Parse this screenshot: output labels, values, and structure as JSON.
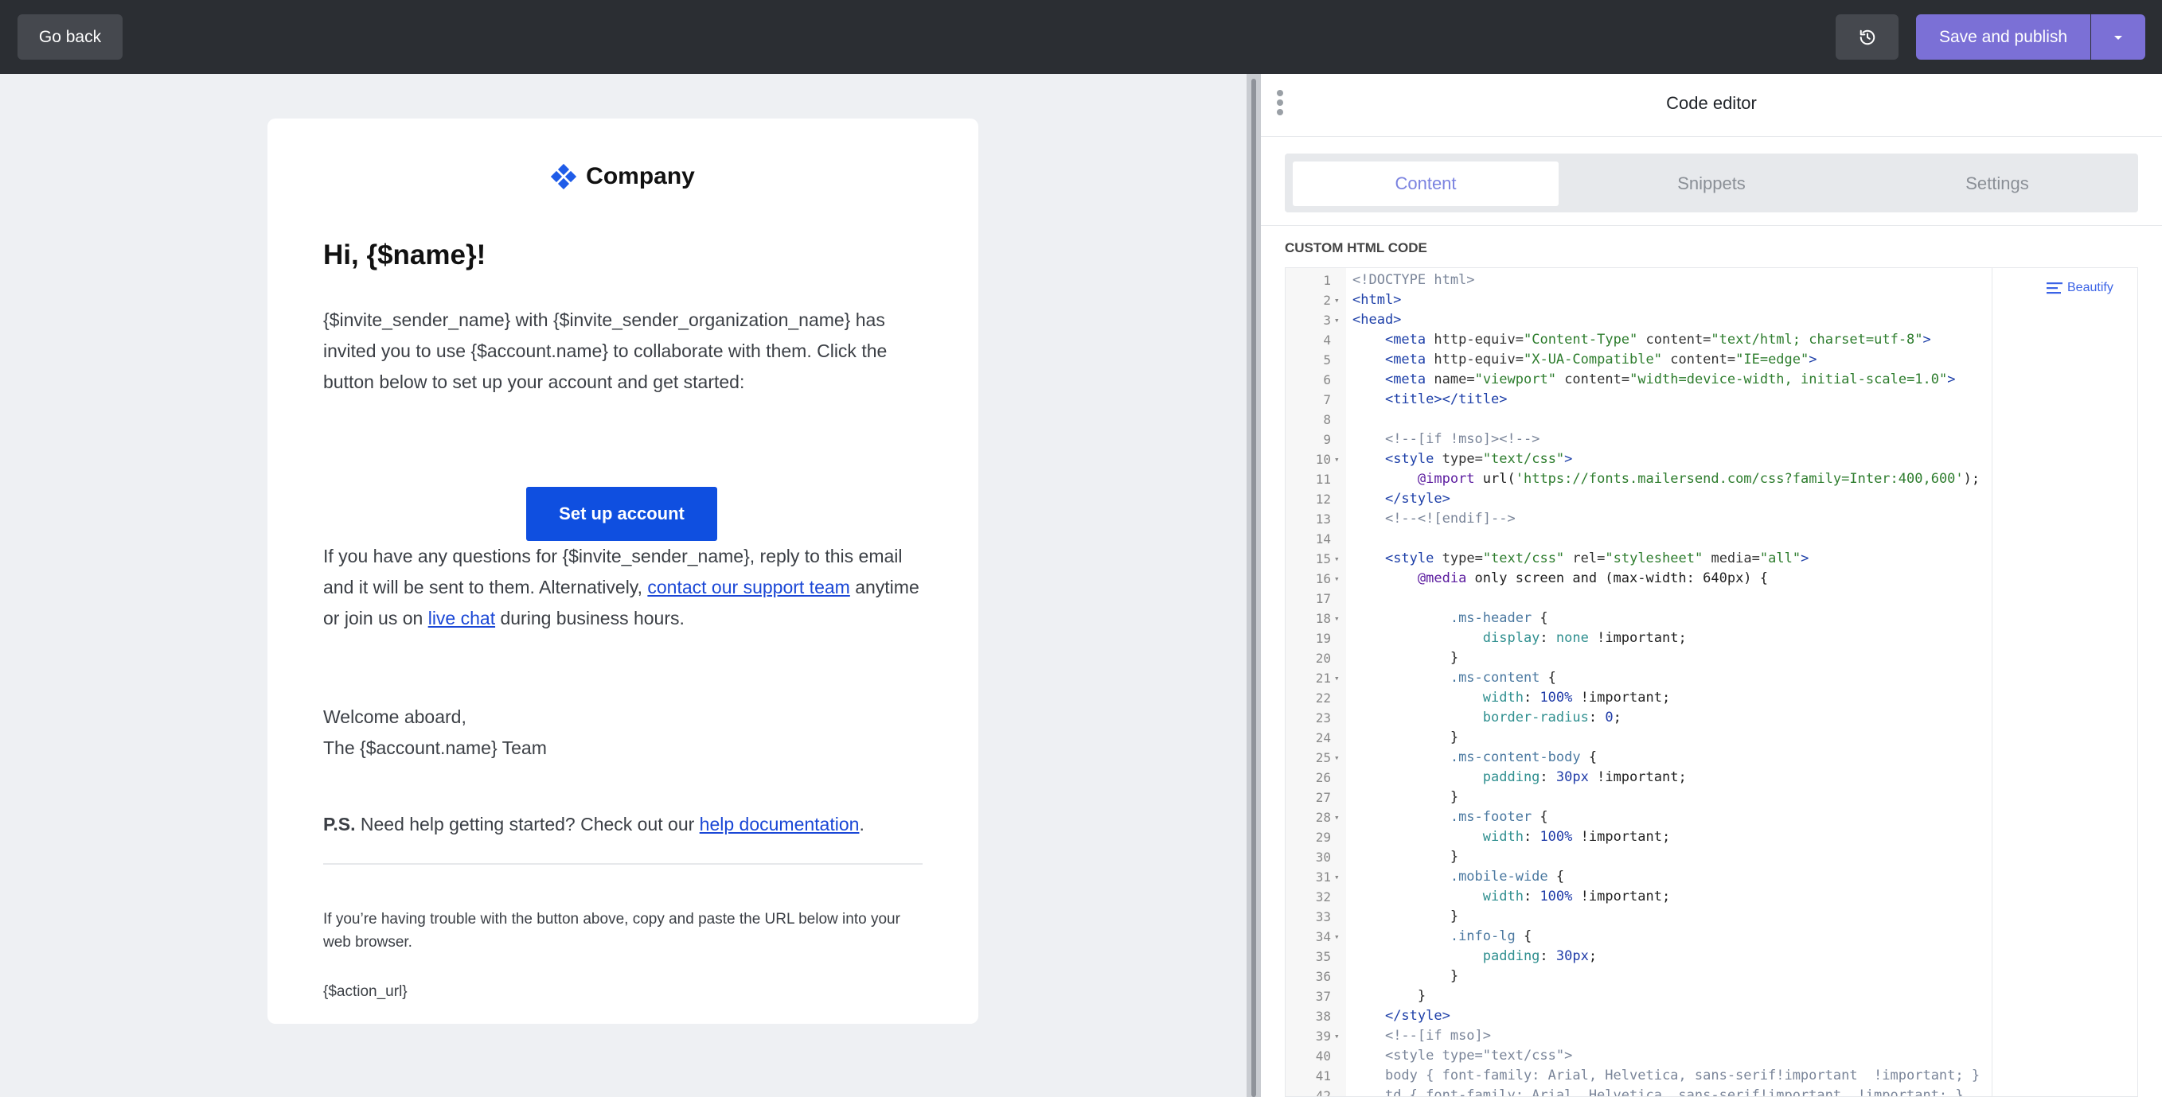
{
  "topbar": {
    "back_label": "Go back",
    "publish_label": "Save and publish",
    "history_icon": "history-icon",
    "caret_icon": "chevron-down-icon"
  },
  "email": {
    "logo_text": "Company",
    "greeting": "Hi, {$name}!",
    "paragraph1": "{$invite_sender_name} with {$invite_sender_organization_name} has invited you to use {$account.name} to collaborate with them. Click the button below to set up your account and get started:",
    "cta_label": "Set up account",
    "paragraph2_a": "If you have any questions for {$invite_sender_name}, reply to this email and it will be sent to them. Alternatively, ",
    "paragraph2_link1": "contact our support team",
    "paragraph2_b": " anytime or join us on ",
    "paragraph2_link2": "live chat",
    "paragraph2_c": " during business hours.",
    "signoff1": "Welcome aboard,",
    "signoff2": "The {$account.name} Team",
    "ps_label": "P.S.",
    "ps_text": " Need help getting started? Check out our ",
    "ps_link": "help documentation",
    "ps_end": ".",
    "trouble_text": "If you’re having trouble with the button above, copy and paste the URL below into your web browser.",
    "action_url": "{$action_url}"
  },
  "panel": {
    "title": "Code editor",
    "tabs": [
      "Content",
      "Snippets",
      "Settings"
    ],
    "active_tab": "Content",
    "section_label": "CUSTOM HTML CODE",
    "beautify_label": "Beautify"
  },
  "code_lines": [
    {
      "n": "1",
      "fold": false,
      "html": "<span class=\"com\">&lt;!DOCTYPE html&gt;</span>"
    },
    {
      "n": "2",
      "fold": true,
      "html": "<span class=\"tag\">&lt;html&gt;</span>"
    },
    {
      "n": "3",
      "fold": true,
      "html": "<span class=\"tag\">&lt;head&gt;</span>"
    },
    {
      "n": "4",
      "fold": false,
      "html": "    <span class=\"tag\">&lt;meta</span> <span class=\"att\">http-equiv=</span><span class=\"str\">\"Content-Type\"</span> <span class=\"att\">content=</span><span class=\"str\">\"text/html; charset=utf-8\"</span><span class=\"tag\">&gt;</span>"
    },
    {
      "n": "5",
      "fold": false,
      "html": "    <span class=\"tag\">&lt;meta</span> <span class=\"att\">http-equiv=</span><span class=\"str\">\"X-UA-Compatible\"</span> <span class=\"att\">content=</span><span class=\"str\">\"IE=edge\"</span><span class=\"tag\">&gt;</span>"
    },
    {
      "n": "6",
      "fold": false,
      "html": "    <span class=\"tag\">&lt;meta</span> <span class=\"att\">name=</span><span class=\"str\">\"viewport\"</span> <span class=\"att\">content=</span><span class=\"str\">\"width=device-width, initial-scale=1.0\"</span><span class=\"tag\">&gt;</span>"
    },
    {
      "n": "7",
      "fold": false,
      "html": "    <span class=\"tag\">&lt;title&gt;&lt;/title&gt;</span>"
    },
    {
      "n": "8",
      "fold": false,
      "html": ""
    },
    {
      "n": "9",
      "fold": false,
      "html": "    <span class=\"com\">&lt;!--[if !mso]&gt;&lt;!--&gt;</span>"
    },
    {
      "n": "10",
      "fold": true,
      "html": "    <span class=\"tag\">&lt;style</span> <span class=\"att\">type=</span><span class=\"str\">\"text/css\"</span><span class=\"tag\">&gt;</span>"
    },
    {
      "n": "11",
      "fold": false,
      "html": "        <span class=\"kw\">@import</span> url(<span class=\"str\">'https://fonts.mailersend.com/css?family=Inter:400,600'</span>);"
    },
    {
      "n": "12",
      "fold": false,
      "html": "    <span class=\"tag\">&lt;/style&gt;</span>"
    },
    {
      "n": "13",
      "fold": false,
      "html": "    <span class=\"com\">&lt;!--&lt;![endif]--&gt;</span>"
    },
    {
      "n": "14",
      "fold": false,
      "html": ""
    },
    {
      "n": "15",
      "fold": true,
      "html": "    <span class=\"tag\">&lt;style</span> <span class=\"att\">type=</span><span class=\"str\">\"text/css\"</span> <span class=\"att\">rel=</span><span class=\"str\">\"stylesheet\"</span> <span class=\"att\">media=</span><span class=\"str\">\"all\"</span><span class=\"tag\">&gt;</span>"
    },
    {
      "n": "16",
      "fold": true,
      "html": "        <span class=\"kw\">@media</span> only screen and (max-width: 640px) {"
    },
    {
      "n": "17",
      "fold": false,
      "html": ""
    },
    {
      "n": "18",
      "fold": true,
      "html": "            <span class=\"sel\">.ms-header</span> {"
    },
    {
      "n": "19",
      "fold": false,
      "html": "                <span class=\"prop\">display</span>: <span class=\"prop\">none</span> !important;"
    },
    {
      "n": "20",
      "fold": false,
      "html": "            }"
    },
    {
      "n": "21",
      "fold": true,
      "html": "            <span class=\"sel\">.ms-content</span> {"
    },
    {
      "n": "22",
      "fold": false,
      "html": "                <span class=\"prop\">width</span>: <span class=\"num\">100%</span> !important;"
    },
    {
      "n": "23",
      "fold": false,
      "html": "                <span class=\"prop\">border-radius</span>: <span class=\"num\">0</span>;"
    },
    {
      "n": "24",
      "fold": false,
      "html": "            }"
    },
    {
      "n": "25",
      "fold": true,
      "html": "            <span class=\"sel\">.ms-content-body</span> {"
    },
    {
      "n": "26",
      "fold": false,
      "html": "                <span class=\"prop\">padding</span>: <span class=\"num\">30px</span> !important;"
    },
    {
      "n": "27",
      "fold": false,
      "html": "            }"
    },
    {
      "n": "28",
      "fold": true,
      "html": "            <span class=\"sel\">.ms-footer</span> {"
    },
    {
      "n": "29",
      "fold": false,
      "html": "                <span class=\"prop\">width</span>: <span class=\"num\">100%</span> !important;"
    },
    {
      "n": "30",
      "fold": false,
      "html": "            }"
    },
    {
      "n": "31",
      "fold": true,
      "html": "            <span class=\"sel\">.mobile-wide</span> {"
    },
    {
      "n": "32",
      "fold": false,
      "html": "                <span class=\"prop\">width</span>: <span class=\"num\">100%</span> !important;"
    },
    {
      "n": "33",
      "fold": false,
      "html": "            }"
    },
    {
      "n": "34",
      "fold": true,
      "html": "            <span class=\"sel\">.info-lg</span> {"
    },
    {
      "n": "35",
      "fold": false,
      "html": "                <span class=\"prop\">padding</span>: <span class=\"num\">30px</span>;"
    },
    {
      "n": "36",
      "fold": false,
      "html": "            }"
    },
    {
      "n": "37",
      "fold": false,
      "html": "        }"
    },
    {
      "n": "38",
      "fold": false,
      "html": "    <span class=\"tag\">&lt;/style&gt;</span>"
    },
    {
      "n": "39",
      "fold": true,
      "html": "    <span class=\"com\">&lt;!--[if mso]&gt;</span>"
    },
    {
      "n": "40",
      "fold": false,
      "html": "    <span class=\"com\">&lt;style type=\"text/css\"&gt;</span>"
    },
    {
      "n": "41",
      "fold": false,
      "html": "    <span class=\"com\">body { font-family: Arial, Helvetica, sans-serif!important  !important; }</span>"
    },
    {
      "n": "42",
      "fold": false,
      "html": "    <span class=\"com\">td { font-family: Arial, Helvetica, sans-serif!important  !important; }</span>"
    }
  ]
}
